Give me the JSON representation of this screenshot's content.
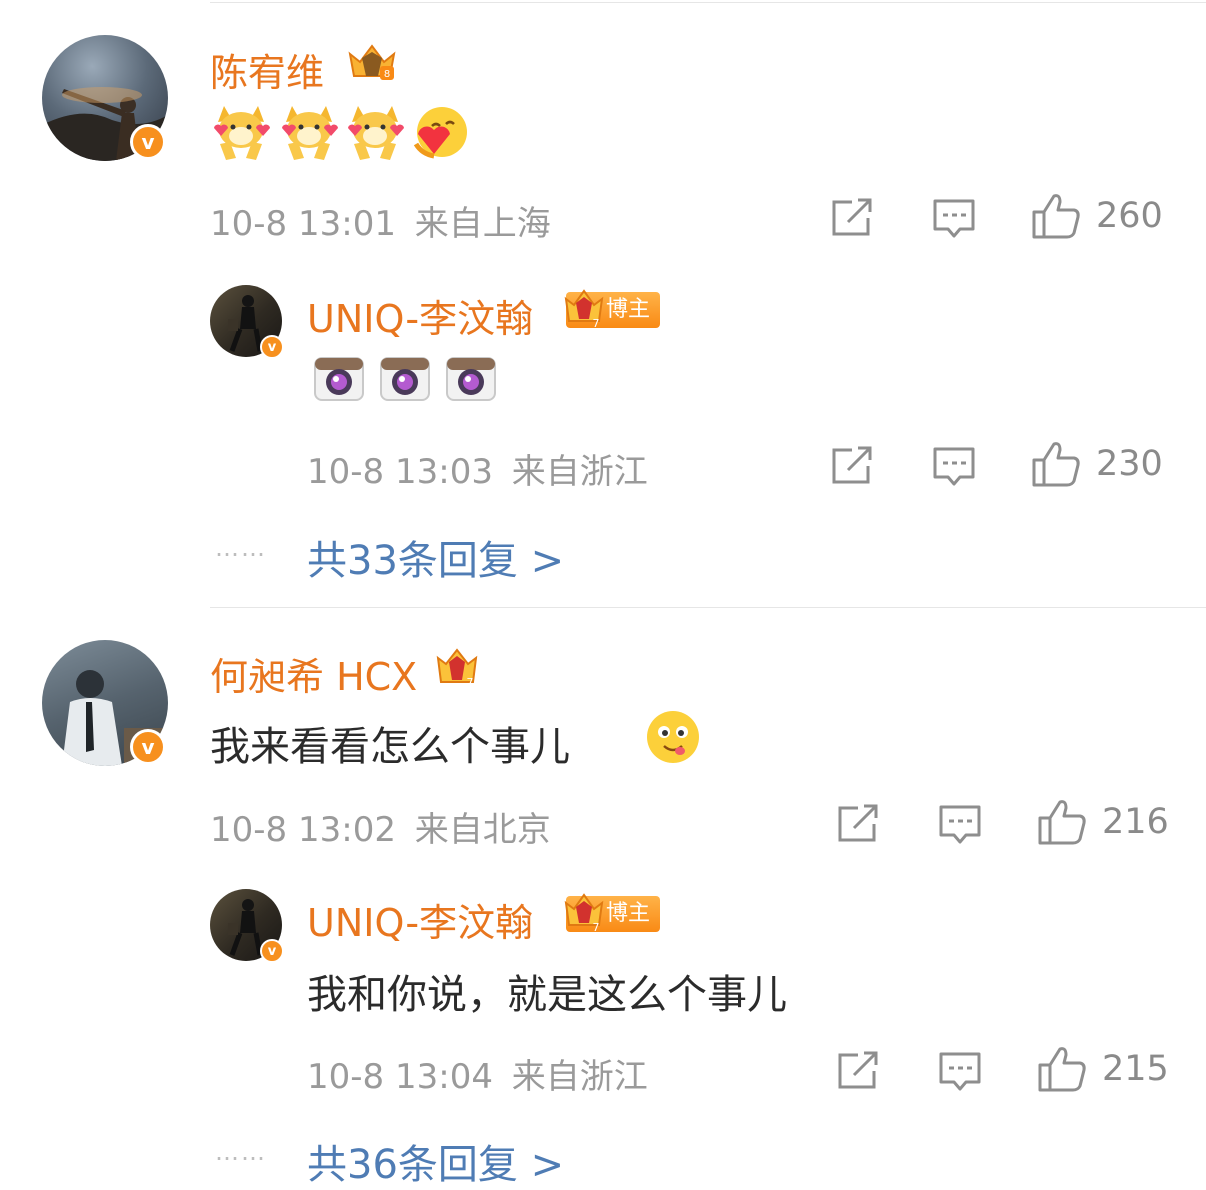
{
  "comments": [
    {
      "user": "陈宥维",
      "emoji_row": [
        "shiba-heart-emoji",
        "shiba-heart-emoji",
        "shiba-heart-emoji",
        "hug-heart-emoji"
      ],
      "time": "10-8 13:01",
      "location": "来自上海",
      "likes": "260",
      "reply": {
        "user": "UNIQ-李汶翰",
        "tag": "博主",
        "emoji_row": [
          "camera-emoji",
          "camera-emoji",
          "camera-emoji"
        ],
        "time": "10-8 13:03",
        "location": "来自浙江",
        "likes": "230"
      },
      "more_replies": "共33条回复 >"
    },
    {
      "user": "何昶希 HCX",
      "text": "我来看看怎么个事儿",
      "text_emoji": "drool-face-emoji",
      "time": "10-8 13:02",
      "location": "来自北京",
      "likes": "216",
      "reply": {
        "user": "UNIQ-李汶翰",
        "tag": "博主",
        "text": "我和你说，就是这么个事儿",
        "time": "10-8 13:04",
        "location": "来自浙江",
        "likes": "215"
      },
      "more_replies": "共36条回复 >"
    }
  ],
  "dots": "……",
  "verified_mark": "v",
  "colors": {
    "name": "#e8761f",
    "link": "#4f7cb4",
    "meta": "#9a9a9a",
    "badge": "#f7901e"
  }
}
